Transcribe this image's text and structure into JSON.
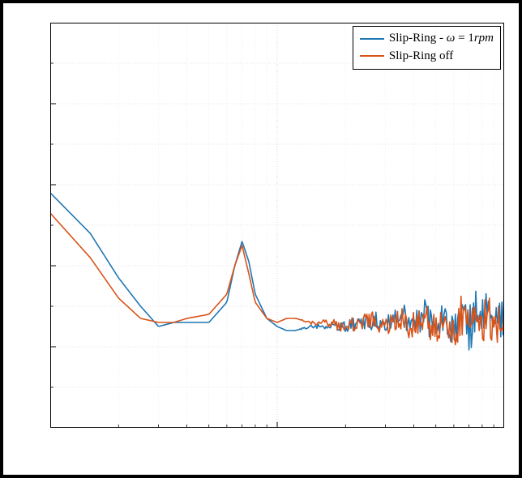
{
  "chart_data": {
    "type": "line",
    "title": "",
    "xlabel": "",
    "ylabel": "",
    "xscale": "log",
    "xlim": [
      1,
      100
    ],
    "ylim": [
      0,
      1
    ],
    "legend_position": "top-right",
    "grid": true,
    "series": [
      {
        "name": "Slip-Ring - ω = 1rpm",
        "color": "#1f77b4",
        "x": [
          1,
          1.5,
          2,
          2.5,
          3,
          3.5,
          4,
          5,
          6,
          6.5,
          7,
          7.5,
          8,
          9,
          10,
          11,
          12,
          14,
          16,
          20,
          25,
          30,
          35,
          40,
          45,
          50,
          55,
          60,
          65,
          70,
          75,
          80,
          85,
          90,
          95,
          100
        ],
        "y": [
          0.58,
          0.48,
          0.37,
          0.3,
          0.25,
          0.26,
          0.26,
          0.26,
          0.31,
          0.4,
          0.46,
          0.41,
          0.33,
          0.27,
          0.25,
          0.24,
          0.24,
          0.25,
          0.25,
          0.25,
          0.26,
          0.26,
          0.28,
          0.26,
          0.28,
          0.24,
          0.28,
          0.24,
          0.3,
          0.24,
          0.28,
          0.26,
          0.3,
          0.24,
          0.26,
          0.28
        ]
      },
      {
        "name": "Slip-Ring off",
        "color": "#d95319",
        "x": [
          1,
          1.5,
          2,
          2.5,
          3,
          3.5,
          4,
          5,
          6,
          6.5,
          7,
          7.5,
          8,
          9,
          10,
          11,
          12,
          14,
          16,
          20,
          25,
          30,
          35,
          40,
          45,
          50,
          55,
          60,
          65,
          70,
          75,
          80,
          85,
          90,
          95,
          100
        ],
        "y": [
          0.53,
          0.42,
          0.32,
          0.27,
          0.26,
          0.26,
          0.27,
          0.28,
          0.33,
          0.4,
          0.45,
          0.38,
          0.31,
          0.27,
          0.26,
          0.27,
          0.27,
          0.26,
          0.26,
          0.25,
          0.27,
          0.25,
          0.27,
          0.25,
          0.28,
          0.23,
          0.29,
          0.22,
          0.28,
          0.25,
          0.27,
          0.24,
          0.3,
          0.23,
          0.27,
          0.26
        ]
      }
    ]
  },
  "legend": {
    "items": [
      {
        "label_html": "Slip-Ring - <span class=\"greek\">ω</span> = 1<span class=\"greek\">rpm</span>",
        "color": "#1f77b4"
      },
      {
        "label_html": "Slip-Ring off",
        "color": "#d95319"
      }
    ]
  },
  "colors": {
    "series1": "#1f77b4",
    "series2": "#d95319",
    "grid_major": "#cccccc",
    "grid_minor": "#e6e6e6",
    "axis": "#000000"
  }
}
